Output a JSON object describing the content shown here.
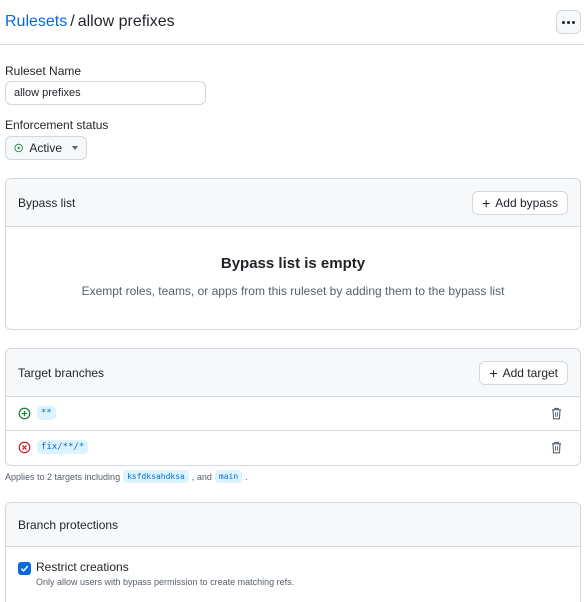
{
  "breadcrumb": {
    "parent": "Rulesets",
    "separator": "/",
    "current": "allow prefixes"
  },
  "form": {
    "name_label": "Ruleset Name",
    "name_value": "allow prefixes",
    "enforcement_label": "Enforcement status",
    "enforcement_value": "Active"
  },
  "bypass": {
    "title": "Bypass list",
    "add_label": "Add bypass",
    "empty_title": "Bypass list is empty",
    "empty_desc": "Exempt roles, teams, or apps from this ruleset by adding them to the bypass list"
  },
  "targets": {
    "title": "Target branches",
    "add_label": "Add target",
    "rows": [
      {
        "kind": "include",
        "pattern": "**"
      },
      {
        "kind": "exclude",
        "pattern": "fix/**/*"
      }
    ],
    "applies_prefix": "Applies to 2 targets including",
    "applies_items": [
      "ksfdksahdksa",
      "main"
    ],
    "applies_joiner": ", and",
    "applies_suffix": "."
  },
  "protections": {
    "title": "Branch protections",
    "items": [
      {
        "title": "Restrict creations",
        "desc": "Only allow users with bypass permission to create matching refs.",
        "checked": true
      }
    ]
  },
  "colors": {
    "accent": "#0969da",
    "success": "#1a7f37",
    "danger": "#cf222e",
    "border": "#d0d7de"
  }
}
